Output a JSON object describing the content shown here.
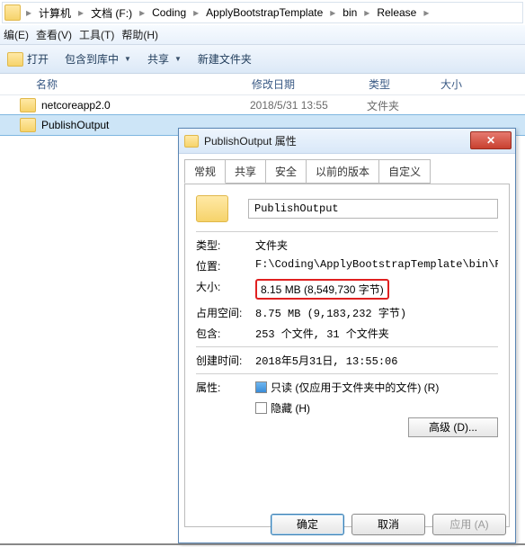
{
  "breadcrumb": [
    "计算机",
    "文档 (F:)",
    "Coding",
    "ApplyBootstrapTemplate",
    "bin",
    "Release"
  ],
  "menu": {
    "edit": "编(E)",
    "view": "查看(V)",
    "tools": "工具(T)",
    "help": "帮助(H)"
  },
  "toolbar": {
    "open": "打开",
    "include": "包含到库中",
    "share": "共享",
    "newfolder": "新建文件夹"
  },
  "columns": {
    "name": "名称",
    "date": "修改日期",
    "type": "类型",
    "size": "大小"
  },
  "files": [
    {
      "name": "netcoreapp2.0",
      "date": "2018/5/31 13:55",
      "type": "文件夹"
    },
    {
      "name": "PublishOutput",
      "date": "",
      "type": ""
    }
  ],
  "dlg": {
    "title": "PublishOutput 属性",
    "tabs": {
      "general": "常规",
      "share": "共享",
      "security": "安全",
      "prev": "以前的版本",
      "custom": "自定义"
    },
    "name": "PublishOutput",
    "rows": {
      "type_l": "类型:",
      "type_v": "文件夹",
      "loc_l": "位置:",
      "loc_v": "F:\\Coding\\ApplyBootstrapTemplate\\bin\\Rele",
      "size_l": "大小:",
      "size_v": "8.15 MB (8,549,730 字节)",
      "disk_l": "占用空间:",
      "disk_v": "8.75 MB (9,183,232 字节)",
      "cont_l": "包含:",
      "cont_v": "253 个文件, 31 个文件夹",
      "ctime_l": "创建时间:",
      "ctime_v": "2018年5月31日, 13:55:06",
      "attr_l": "属性:",
      "ro": "只读 (仅应用于文件夹中的文件) (R)",
      "hidden": "隐藏 (H)",
      "advanced": "高级 (D)..."
    },
    "buttons": {
      "ok": "确定",
      "cancel": "取消",
      "apply": "应用 (A)"
    }
  }
}
